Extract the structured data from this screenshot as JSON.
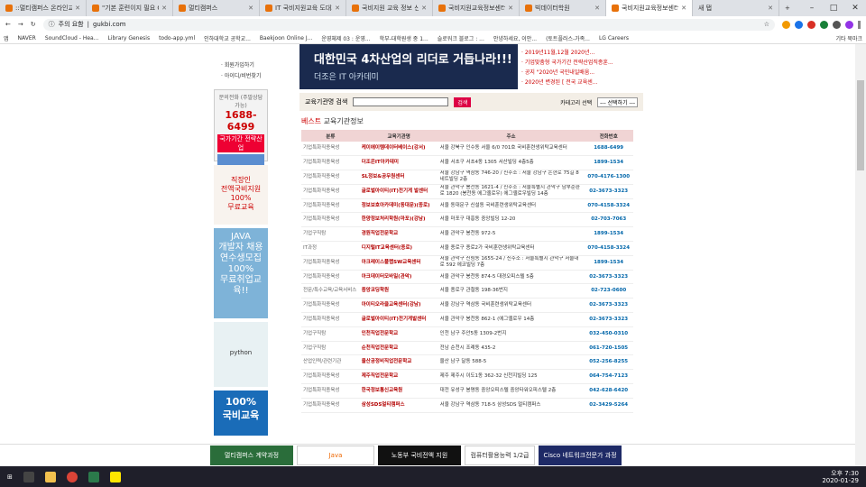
{
  "tabs": [
    {
      "label": "::멀티캠퍼스 온라인교육"
    },
    {
      "label": "\"기본 훈련이지 필요 C"
    },
    {
      "label": "멀티캠퍼스"
    },
    {
      "label": "IT 국비지원교육 도대체"
    },
    {
      "label": "국비지원 교육 정보 신"
    },
    {
      "label": "국비지원교육정보센터"
    },
    {
      "label": "빅데이터학원"
    },
    {
      "label": "국비지원교육정보센터",
      "active": true
    },
    {
      "label": "새 탭"
    }
  ],
  "address": {
    "security": "주의 요함",
    "url": "gukbi.com"
  },
  "bookmarks": [
    "앱",
    "NAVER",
    "SoundCloud - Hea...",
    "Library Genesis",
    "todo-app.yml",
    "인하대학교 공학교...",
    "Baekjoon Online J...",
    "운영체제 03 : 운영...",
    "학부-대학원생 중 1...",
    "슬로워크 블로그 : ...",
    "안녕하세요, 이안...",
    "(토트플러스-가족...",
    "LG Careers",
    "기타 북마크"
  ],
  "left": {
    "login": [
      "· 회원가입하기",
      "· 아이디/비번찾기"
    ],
    "phone_label": "문의전화 (주말상담가능)",
    "phone": "1688-6499",
    "phone_sub": "국가기간 전략산업",
    "banner1": "직장인\n전액국비지원\n100%\n무료교육",
    "banner2": "JAVA\n개발자 채용\n연수생모집\n100%\n무료취업교육!!",
    "banner3": "python",
    "banner4": "100%\n국비교육"
  },
  "hero": {
    "title": "대한민국 4차산업의 리더로 거듭나라!!!",
    "sub": "더조은 IT 아카데미"
  },
  "news": [
    "· 2019년11월,12월 2020년...",
    "· 기업맞춤형 국가기간 전략산업직종훈...",
    "· 공지 \"2020년 국민내일배움...",
    "· 2020년 변경된 [ 전국 교육센..."
  ],
  "search": {
    "label": "교육기관명 검색",
    "button": "검색",
    "category": "카테고리 선택",
    "select": "--- 선택하기 ---"
  },
  "section": {
    "best": "베스트",
    "title": "교육기관정보"
  },
  "table": {
    "headers": [
      "분류",
      "교육기관명",
      "주소",
      "전화번호"
    ],
    "rows": [
      [
        "기업특화직종육성",
        "케이에이템데이터베이스(강서)",
        "서울 강북구 인수동 서울 6/0 701호 국비훈련생위탁교육센터",
        "1688-6499"
      ],
      [
        "기업특화직종육성",
        "더조은IT아카데미",
        "서울 서초구 서초4동 1305 서산빌딩 4층5층",
        "1899-1534"
      ],
      [
        "기업특화직종육성",
        "SL정보&공무원센터",
        "서울 강남구 역삼동 746-20 / 신주소 : 서울 강남구 논현로 75길 8 네트빌딩 2층",
        "070-4176-1300"
      ],
      [
        "기업특화직종육성",
        "글로벌아이티(IT)전기게 발센터",
        "서울 관악구 봉천동 1621-4 / 신주소 : 서울특별시 관악구 남부순환로 1820 (봉천동 에그옐로우) 에그옐로우빌딩 14층",
        "02-3673-3323"
      ],
      [
        "기업특화직종육성",
        "정보보호아카데미(동대문)(종로)",
        "서울 동대문구 신설동 국비훈련생위탁교육센터",
        "070-4158-3324"
      ],
      [
        "기업특화직종육성",
        "한양정보처리학원(마포)(강남)",
        "서울 마포구 대흥동 중앙빌딩 12-20",
        "02-703-7063"
      ],
      [
        "기업구직탐",
        "경원직업전문학교",
        "서울 관악구 봉천동 972-5",
        "1899-1534"
      ],
      [
        "IT과정",
        "디지털IT교육센터(종로)",
        "서울 종로구 종로2가 국비훈련생위탁교육센터",
        "070-4158-3324"
      ],
      [
        "기업특화직종육성",
        "아크레이스플랩SW교육센터",
        "서울 관악구 신림동 1655-24 / 신주소 : 서울특별시 관악구 서울대로 592 에코빌딩 7층",
        "1899-1534"
      ],
      [
        "기업특화직종육성",
        "아크데이터모바일(관악)",
        "서울 관악구 봉천동 874-5 대경오피스텔 5층",
        "02-3673-3323"
      ],
      [
        "전문/특수교육/교육서비스",
        "중앙코딩학원",
        "서울 종로구 관철동 198-36번지",
        "02-723-0600"
      ],
      [
        "기업특화직종육성",
        "아이티오라클교육센터(강남)",
        "서울 강남구 역삼동 국비훈련생위탁교육센터",
        "02-3673-3323"
      ],
      [
        "기업특화직종육성",
        "글로벌아이티(IT)전기게발센터",
        "서울 관악구 봉천동 862-1 (에그옐로우 14층",
        "02-3673-3323"
      ],
      [
        "기업구직탐",
        "인천직업전문학교",
        "인천 남구 주안5동 1309-2번지",
        "032-450-0310"
      ],
      [
        "기업구직탐",
        "순천직업전문학교",
        "전남 순천시 조례동 435-2",
        "061-720-1505"
      ],
      [
        "산업인력/관련기관",
        "울산공정비직업전문학교",
        "울산 남구 달동 588-5",
        "052-256-8255"
      ],
      [
        "기업특화직종육성",
        "제주직업전문학교",
        "제주 제주시 이도1동 362-32 신천지빌딩 125",
        "064-754-7123"
      ],
      [
        "기업특화직종육성",
        "한국정보통신교육원",
        "대전 유성구 봉명동 중앙오피스텔 중앙타워오피스텔 2층",
        "042-628-6420"
      ],
      [
        "기업특화직종육성",
        "삼성SDS멀티캠퍼스",
        "서울 강남구 역삼동 718-5 삼성SDS 멀티캠퍼스",
        "02-3429-5264"
      ]
    ]
  },
  "footer": [
    "멀티캠퍼스 계약과정",
    "Java",
    "노동부 국비전액 지원",
    "컴퓨터활용능력 1/2급",
    "Cisco 네트워크전문가 과정"
  ],
  "taskbar": {
    "time": "오후 7:30",
    "date": "2020-01-29"
  },
  "colors": {
    "accent": "#c00",
    "header_bg": "#f0d4d4",
    "hero_bg": "#1a2a4e"
  }
}
